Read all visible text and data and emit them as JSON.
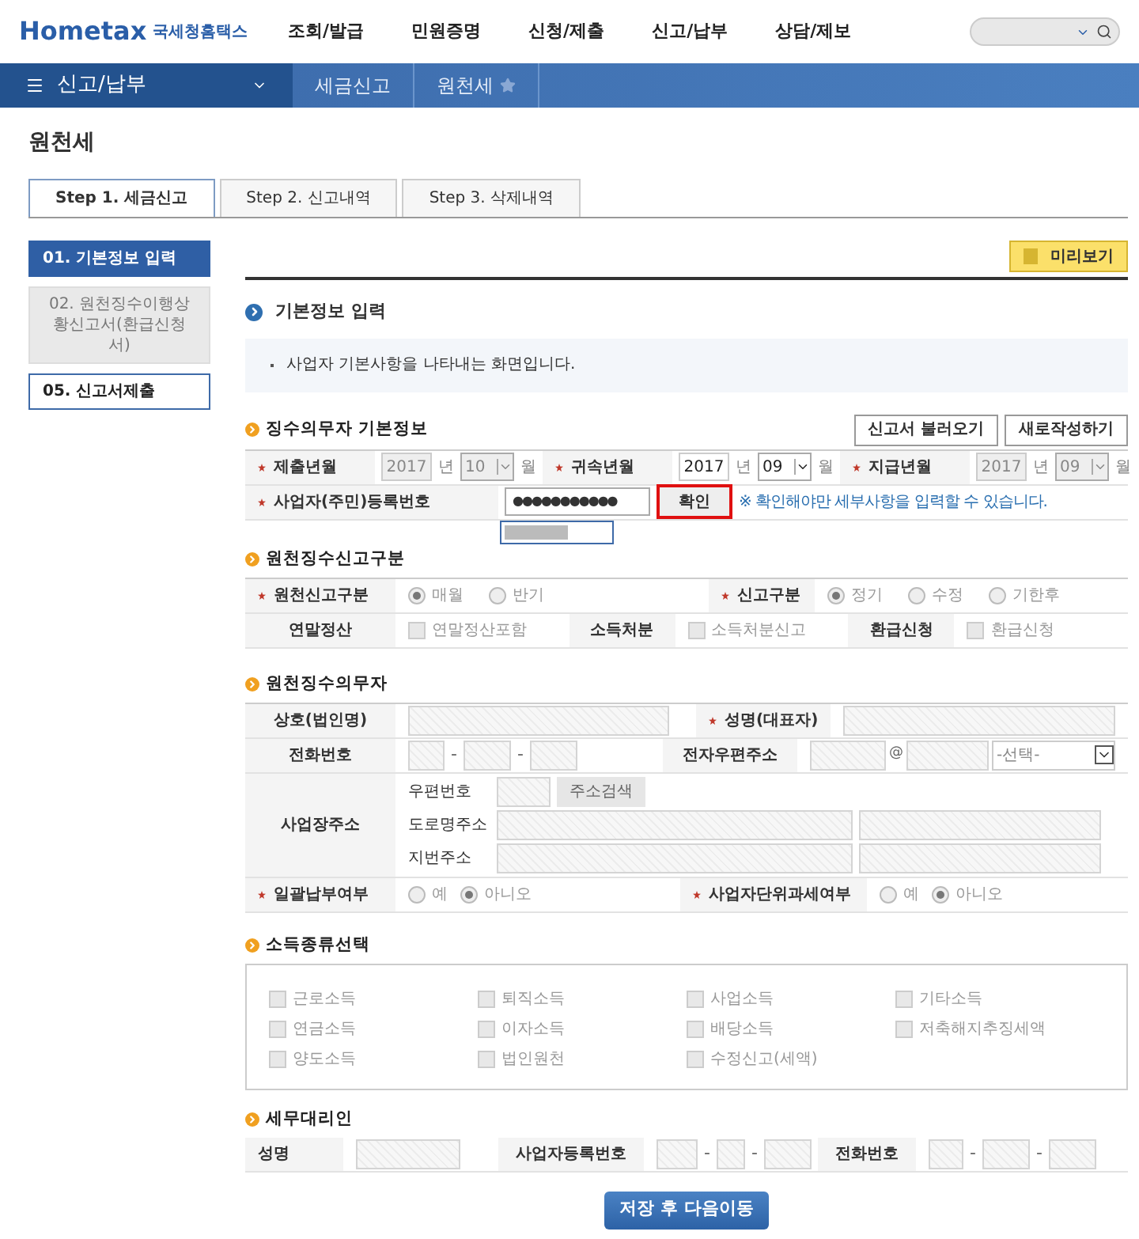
{
  "logo": {
    "brand": "Hometax",
    "name": "국세청홈택스"
  },
  "nav": [
    "조회/발급",
    "민원증명",
    "신청/제출",
    "신고/납부",
    "상담/제보"
  ],
  "breadcrumb": {
    "menu": "신고/납부",
    "items": [
      "세금신고",
      "원천세"
    ]
  },
  "page_title": "원천세",
  "tabs": [
    {
      "label": "Step 1. 세금신고",
      "selected": true
    },
    {
      "label": "Step 2. 신고내역",
      "selected": false
    },
    {
      "label": "Step 3. 삭제내역",
      "selected": false
    }
  ],
  "steps": [
    {
      "label": "01. 기본정보 입력",
      "selected": true,
      "disabled": false
    },
    {
      "label": "02. 원천징수이행상황신고서(환급신청서)",
      "selected": false,
      "disabled": true
    },
    {
      "label": "05. 신고서제출",
      "selected": false,
      "disabled": false
    }
  ],
  "preview_button": "미리보기",
  "form_title": "기본정보 입력",
  "info": "사업자 기본사항을 나타내는 화면입니다.",
  "basic": {
    "title": "징수의무자 기본정보",
    "buttons": [
      "신고서 불러오기",
      "새로작성하기"
    ],
    "dates": [
      {
        "label": "제출년월",
        "required": true,
        "year": "2017",
        "year_unit": "년",
        "month": "10",
        "month_unit": "월",
        "disabled": true
      },
      {
        "label": "귀속년월",
        "required": true,
        "year": "2017",
        "year_unit": "년",
        "month": "09",
        "month_unit": "월",
        "disabled": false
      },
      {
        "label": "지급년월",
        "required": true,
        "year": "2017",
        "year_unit": "년",
        "month": "09",
        "month_unit": "월",
        "disabled": true
      }
    ],
    "id": {
      "label": "사업자(주민)등록번호",
      "required": true,
      "value": "●●●●●●●●●●●",
      "confirm": "확인",
      "highlighted": true,
      "note": "※ 확인해야만 세부사항을 입력할 수 있습니다."
    }
  },
  "division": {
    "title": "원천징수신고구분",
    "rows": [
      [
        {
          "label": "원천신고구분",
          "required": true,
          "kind": "radio",
          "options": [
            {
              "label": "매월",
              "selected": true
            },
            {
              "label": "반기",
              "selected": false
            }
          ]
        },
        {
          "label": "신고구분",
          "required": true,
          "kind": "radio",
          "options": [
            {
              "label": "정기",
              "selected": true
            },
            {
              "label": "수정",
              "selected": false
            },
            {
              "label": "기한후",
              "selected": false
            }
          ]
        }
      ],
      [
        {
          "label": "연말정산",
          "required": false,
          "kind": "checkbox",
          "options": [
            {
              "label": "연말정산포함",
              "selected": false
            }
          ]
        },
        {
          "label": "소득처분",
          "required": false,
          "kind": "checkbox",
          "options": [
            {
              "label": "소득처분신고",
              "selected": false
            }
          ]
        },
        {
          "label": "환급신청",
          "required": false,
          "kind": "checkbox",
          "options": [
            {
              "label": "환급신청",
              "selected": false
            }
          ]
        }
      ]
    ]
  },
  "payer": {
    "title": "원천징수의무자",
    "company": {
      "label": "상호(법인명)",
      "required": false
    },
    "rep": {
      "label": "성명(대표자)",
      "required": true
    },
    "phone": {
      "label": "전화번호",
      "separators": [
        "-",
        "-"
      ]
    },
    "email": {
      "label": "전자우편주소",
      "at": "@",
      "select": "-선택-"
    },
    "address": {
      "label": "사업장주소",
      "zip_label": "우편번호",
      "search_button": "주소검색",
      "road_label": "도로명주소",
      "lot_label": "지번주소"
    },
    "bulk": {
      "label": "일괄납부여부",
      "required": true,
      "options": [
        {
          "label": "예",
          "selected": false
        },
        {
          "label": "아니오",
          "selected": true
        }
      ]
    },
    "unit": {
      "label": "사업자단위과세여부",
      "required": true,
      "options": [
        {
          "label": "예",
          "selected": false
        },
        {
          "label": "아니오",
          "selected": true
        }
      ]
    }
  },
  "income": {
    "title": "소득종류선택",
    "items": [
      {
        "label": "근로소득",
        "checked": false
      },
      {
        "label": "퇴직소득",
        "checked": false
      },
      {
        "label": "사업소득",
        "checked": false
      },
      {
        "label": "기타소득",
        "checked": false
      },
      {
        "label": "연금소득",
        "checked": false
      },
      {
        "label": "이자소득",
        "checked": false
      },
      {
        "label": "배당소득",
        "checked": false
      },
      {
        "label": "저축해지추징세액",
        "checked": false
      },
      {
        "label": "양도소득",
        "checked": false
      },
      {
        "label": "법인원천",
        "checked": false
      },
      {
        "label": "수정신고(세액)",
        "checked": false
      }
    ]
  },
  "agent": {
    "title": "세무대리인",
    "name_label": "성명",
    "brn": {
      "label": "사업자등록번호",
      "separators": [
        "-",
        "-"
      ]
    },
    "phone": {
      "label": "전화번호",
      "separators": [
        "-",
        "-"
      ]
    }
  },
  "submit": "저장 후 다음이동"
}
